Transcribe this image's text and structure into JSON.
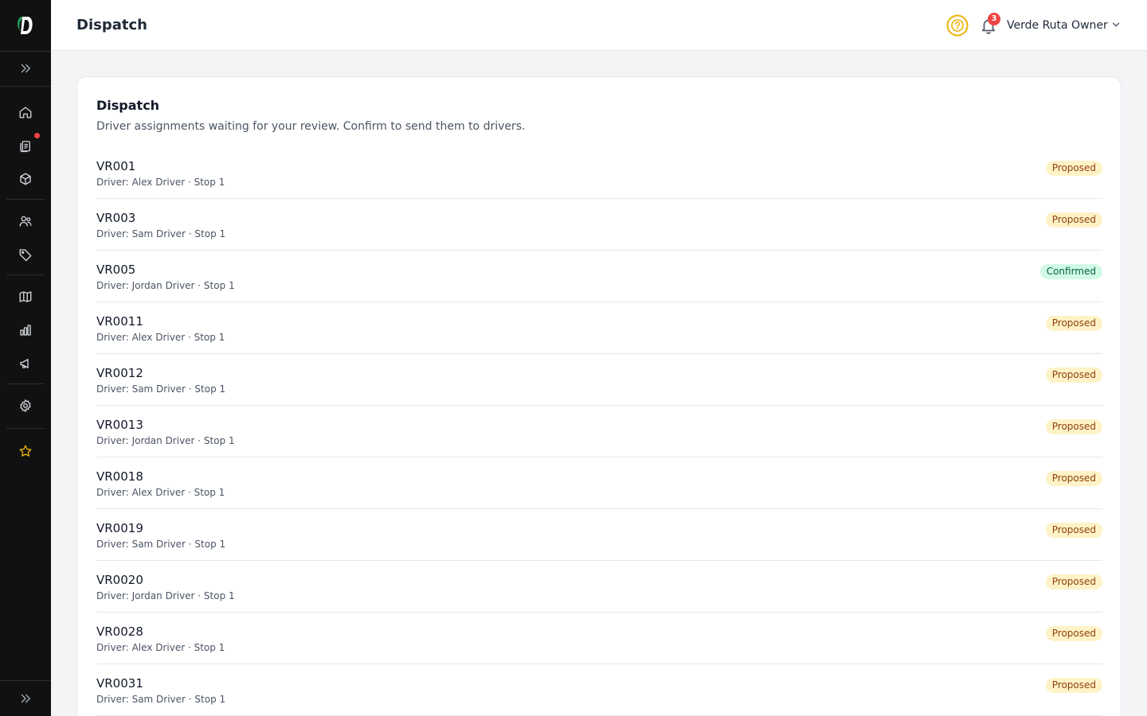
{
  "app": {
    "logo_letter": "D",
    "accent": "#eab308",
    "brand_green": "#22a55b"
  },
  "sidebar": {
    "items": [
      {
        "name": "sidebar-item-home",
        "icon": "home-icon"
      },
      {
        "name": "sidebar-item-orders",
        "icon": "clipboard-icon",
        "has_notification_dot": true
      },
      {
        "name": "sidebar-item-products",
        "icon": "box-icon"
      },
      {
        "name": "sidebar-item-customers",
        "icon": "users-icon"
      },
      {
        "name": "sidebar-item-tags",
        "icon": "tag-icon"
      },
      {
        "name": "sidebar-item-map",
        "icon": "map-icon"
      },
      {
        "name": "sidebar-item-reports",
        "icon": "bar-chart-icon"
      },
      {
        "name": "sidebar-item-marketing",
        "icon": "megaphone-icon"
      },
      {
        "name": "sidebar-item-settings",
        "icon": "gear-icon"
      },
      {
        "name": "sidebar-item-favorites",
        "icon": "star-icon"
      }
    ]
  },
  "header": {
    "title": "Dispatch",
    "notifications_count": "3",
    "user_name": "Verde Ruta Owner"
  },
  "card": {
    "title": "Dispatch",
    "subtitle": "Driver assignments waiting for your review. Confirm to send them to drivers."
  },
  "assignments": [
    {
      "id": "VR001",
      "meta": "Driver: Alex Driver · Stop 1",
      "status": "Proposed",
      "status_kind": "proposed"
    },
    {
      "id": "VR003",
      "meta": "Driver: Sam Driver · Stop 1",
      "status": "Proposed",
      "status_kind": "proposed"
    },
    {
      "id": "VR005",
      "meta": "Driver: Jordan Driver · Stop 1",
      "status": "Confirmed",
      "status_kind": "confirmed"
    },
    {
      "id": "VR0011",
      "meta": "Driver: Alex Driver · Stop 1",
      "status": "Proposed",
      "status_kind": "proposed"
    },
    {
      "id": "VR0012",
      "meta": "Driver: Sam Driver · Stop 1",
      "status": "Proposed",
      "status_kind": "proposed"
    },
    {
      "id": "VR0013",
      "meta": "Driver: Jordan Driver · Stop 1",
      "status": "Proposed",
      "status_kind": "proposed"
    },
    {
      "id": "VR0018",
      "meta": "Driver: Alex Driver · Stop 1",
      "status": "Proposed",
      "status_kind": "proposed"
    },
    {
      "id": "VR0019",
      "meta": "Driver: Sam Driver · Stop 1",
      "status": "Proposed",
      "status_kind": "proposed"
    },
    {
      "id": "VR0020",
      "meta": "Driver: Jordan Driver · Stop 1",
      "status": "Proposed",
      "status_kind": "proposed"
    },
    {
      "id": "VR0028",
      "meta": "Driver: Alex Driver · Stop 1",
      "status": "Proposed",
      "status_kind": "proposed"
    },
    {
      "id": "VR0031",
      "meta": "Driver: Sam Driver · Stop 1",
      "status": "Proposed",
      "status_kind": "proposed"
    }
  ]
}
